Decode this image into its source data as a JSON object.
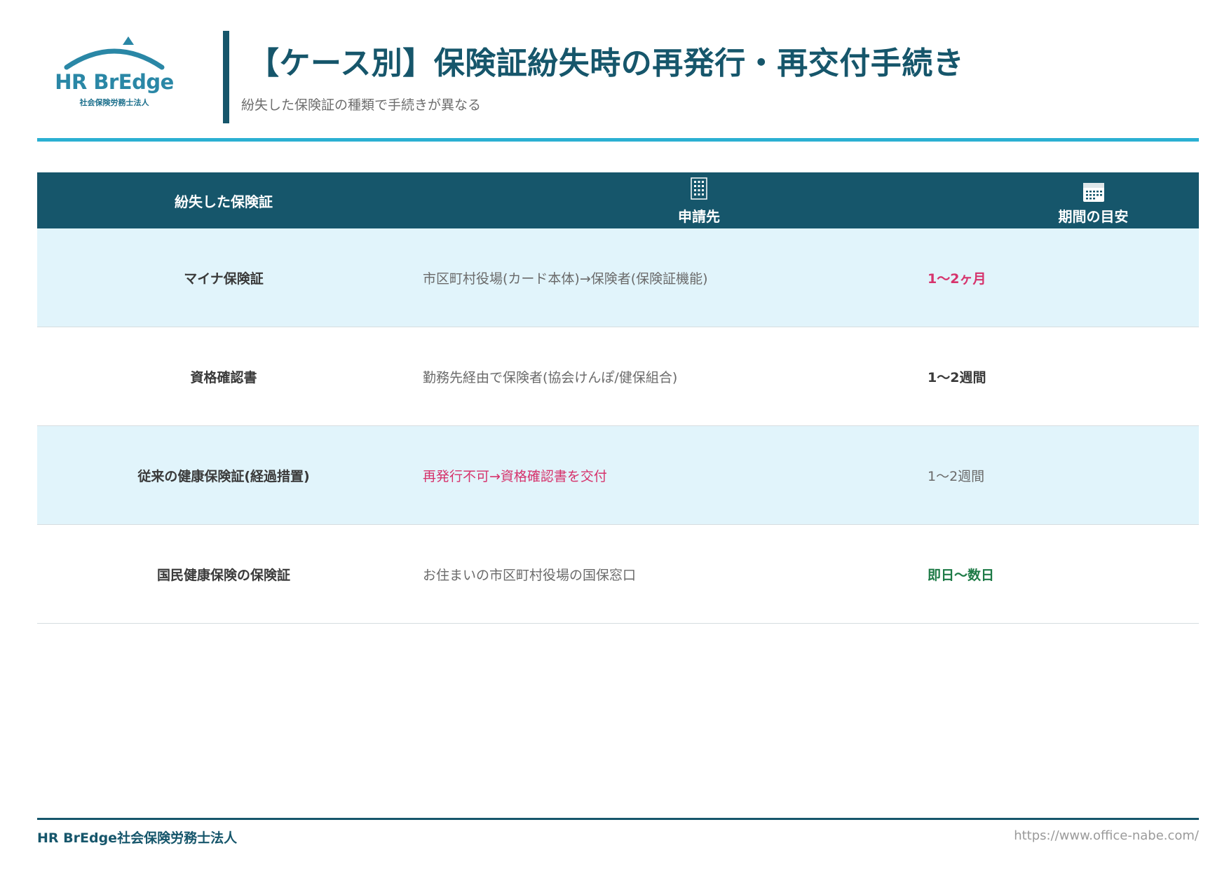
{
  "header": {
    "logo": {
      "name": "HR BrEdge",
      "subtitle": "社会保険労務士法人",
      "icon": "hr-bredge-logo"
    },
    "title": "【ケース別】保険証紛失時の再発行・再交付手続き",
    "subtitle": "紛失した保険証の種類で手続きが異なる"
  },
  "colors": {
    "primary": "#16566b",
    "accent": "#2bb0d2",
    "row_alt": "#e1f4fb",
    "highlight_pink": "#d6336c",
    "highlight_green": "#1d7a46"
  },
  "table": {
    "columns": [
      {
        "label": "紛失した保険証",
        "icon": null
      },
      {
        "label": "申請先",
        "icon": "building-icon"
      },
      {
        "label": "期間の目安",
        "icon": "calendar-icon"
      }
    ],
    "rows": [
      {
        "card": "マイナ保険証",
        "destination": "市区町村役場(カード本体)→保険者(保険証機能)",
        "period": "1〜2ヶ月",
        "period_style": "pink-bold",
        "destination_style": "normal"
      },
      {
        "card": "資格確認書",
        "destination": "勤務先経由で保険者(協会けんぽ/健保組合)",
        "period": "1〜2週間",
        "period_style": "bold",
        "destination_style": "normal"
      },
      {
        "card": "従来の健康保険証(経過措置)",
        "destination": "再発行不可→資格確認書を交付",
        "period": "1〜2週間",
        "period_style": "normal",
        "destination_style": "pink"
      },
      {
        "card": "国民健康保険の保険証",
        "destination": "お住まいの市区町村役場の国保窓口",
        "period": "即日〜数日",
        "period_style": "green-bold",
        "destination_style": "normal"
      }
    ]
  },
  "footer": {
    "left": "HR BrEdge社会保険労務士法人",
    "right": "https://www.office-nabe.com/"
  }
}
